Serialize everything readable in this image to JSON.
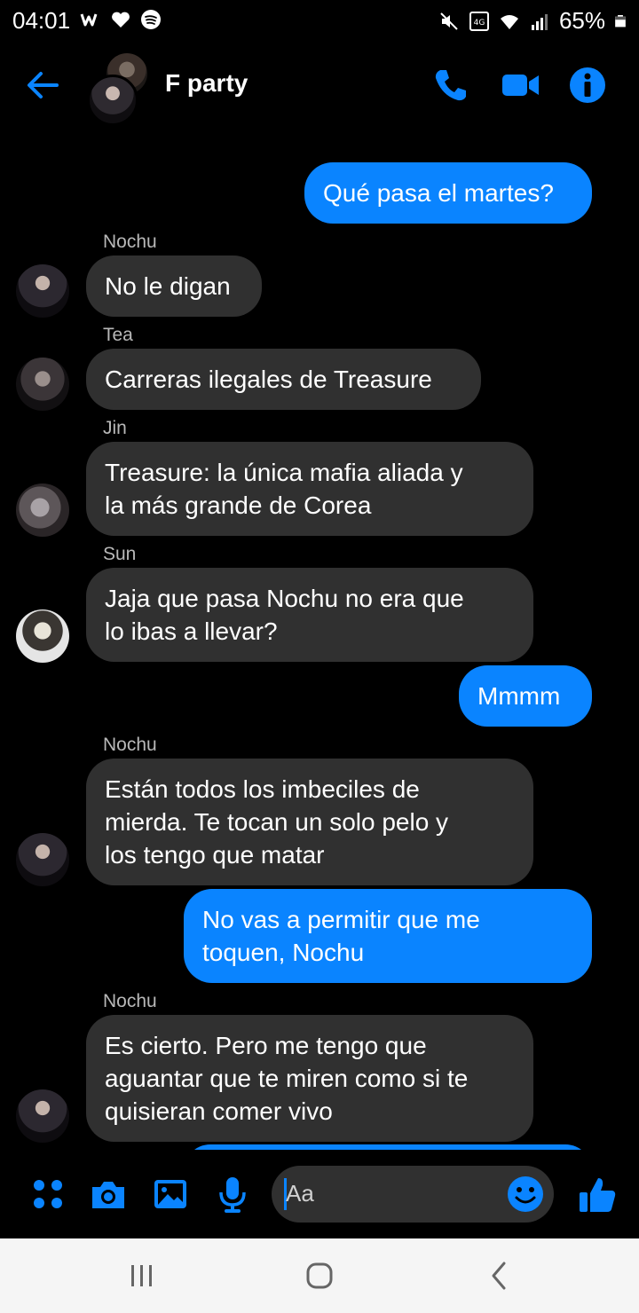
{
  "status_bar": {
    "time": "04:01",
    "battery": "65%",
    "left_icons": [
      "wattpad-icon",
      "heart-icon",
      "spotify-icon"
    ],
    "right_icons": [
      "mute-icon",
      "volte-4g-icon",
      "wifi-icon",
      "signal-icon",
      "battery-icon"
    ]
  },
  "header": {
    "title": "F party",
    "back_icon": "arrow-left-icon",
    "actions": [
      "phone-icon",
      "video-camera-icon",
      "info-icon"
    ]
  },
  "colors": {
    "accent": "#0a84ff",
    "incoming_bubble": "#303030",
    "background": "#000000",
    "nav_bar": "#f5f5f5"
  },
  "messages": [
    {
      "direction": "outgoing",
      "text": "Qué pasa el martes?"
    },
    {
      "direction": "incoming",
      "sender": "Nochu",
      "text": "No le digan"
    },
    {
      "direction": "incoming",
      "sender": "Tea",
      "text": "Carreras ilegales de Treasure"
    },
    {
      "direction": "incoming",
      "sender": "Jin",
      "text": "Treasure: la única mafia aliada y\nla más grande de Corea"
    },
    {
      "direction": "incoming",
      "sender": "Sun",
      "text": "Jaja que pasa Nochu no era que\nlo ibas a llevar?"
    },
    {
      "direction": "outgoing",
      "text": "Mmmm"
    },
    {
      "direction": "incoming",
      "sender": "Nochu",
      "text": "Están todos los imbeciles de\nmierda. Te tocan un solo pelo y\nlos tengo que matar"
    },
    {
      "direction": "outgoing",
      "text": "No vas a permitir que me\ntoquen, Nochu"
    },
    {
      "direction": "incoming",
      "sender": "Nochu",
      "text": "Es cierto. Pero me tengo que\naguantar que te miren como si te\nquisieran comer vivo"
    }
  ],
  "composer": {
    "placeholder": "Aa",
    "buttons": [
      "menu-dots-icon",
      "camera-icon",
      "gallery-icon",
      "microphone-icon"
    ],
    "emoji_icon": "smiley-icon",
    "like_icon": "thumbs-up-icon"
  },
  "nav_bar": [
    "recent-apps-icon",
    "home-icon",
    "back-chevron-icon"
  ]
}
